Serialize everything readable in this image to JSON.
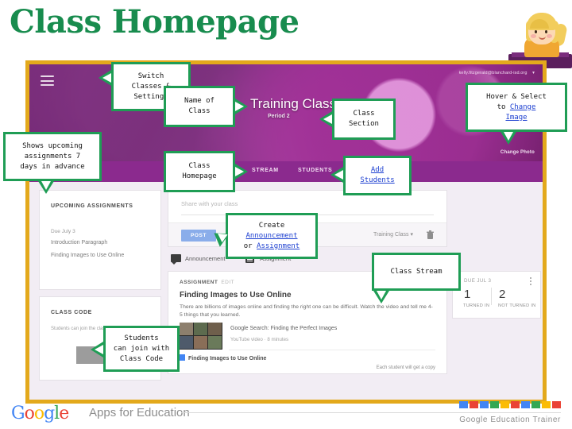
{
  "page": {
    "title": "Class Homepage"
  },
  "screenshot": {
    "hero": {
      "class_name": "Training Class",
      "class_section": "Period 2",
      "account_email": "kelly.fitzgerald@blanchard-isd.org",
      "account_caret": "▾",
      "change_photo": "Change Photo"
    },
    "nav": {
      "tabs": [
        {
          "label": "STREAM"
        },
        {
          "label": "STUDENTS"
        }
      ]
    },
    "upcoming_card": {
      "heading": "UPCOMING ASSIGNMENTS",
      "due_label": "Due July 3",
      "items": [
        "Introduction Paragraph",
        "Finding Images to Use Online"
      ]
    },
    "class_code_card": {
      "heading": "CLASS CODE",
      "description": "Students can join the class with this code.",
      "code_value": ""
    },
    "share_box": {
      "placeholder": "Share with your class",
      "post_label": "POST",
      "class_selector": "Training Class",
      "selector_caret": "▾"
    },
    "post_types": {
      "announcement": "Announcement",
      "assignment": "Assignment"
    },
    "assignment_card": {
      "kicker": "ASSIGNMENT",
      "kicker_muted": "EDIT",
      "title": "Finding Images to Use Online",
      "description": "There are billions of images online and finding the right one can be difficult. Watch the video and tell me 4-5 things that you learned.",
      "attachment_title": "Google Search: Finding the Perfect Images",
      "attachment_sub": "YouTube video · 8 minutes",
      "file_name": "Finding Images to Use Online",
      "copy_note": "Each student will get a copy"
    },
    "status_card": {
      "due": "DUE JUL 3",
      "turned_in_count": "1",
      "turned_in_label": "TURNED IN",
      "not_turned_in_count": "2",
      "not_turned_in_label": "NOT TURNED IN"
    }
  },
  "callouts": {
    "switch": {
      "line1": "Switch",
      "line2": "Classes &",
      "line3": "Settings"
    },
    "upcoming": {
      "line1": "Shows upcoming",
      "line2": "assignments 7",
      "line3": "days in advance"
    },
    "name_of_class": {
      "line1": "Name of",
      "line2": "Class"
    },
    "class_homepage": {
      "line1": "Class",
      "line2": "Homepage"
    },
    "class_section": {
      "line1": "Class",
      "line2": "Section"
    },
    "add_students": {
      "line1": "Add",
      "line2": "Students"
    },
    "change_image": {
      "line1": "Hover & Select",
      "line2_prefix": "to ",
      "line2_link": "Change",
      "line3_link": "Image"
    },
    "create": {
      "line1": "Create",
      "line2_link": "Announcement",
      "line3_prefix": "or ",
      "line3_link": "Assignment"
    },
    "class_stream": {
      "line1": "Class Stream"
    },
    "class_code": {
      "line1": "Students",
      "line2": "can join with",
      "line3": "Class Code"
    }
  },
  "footer": {
    "google": {
      "g1": "G",
      "o1": "o",
      "o2": "o",
      "g2": "g",
      "l": "l",
      "e": "e"
    },
    "apps_for_education": "Apps for Education",
    "trainer_label": "Google Education Trainer",
    "square_colors": [
      "#4285f4",
      "#ea4335",
      "#4285f4",
      "#34a853",
      "#fbbc05",
      "#ea4335",
      "#4285f4",
      "#34a853",
      "#fbbc05",
      "#ea4335"
    ]
  }
}
